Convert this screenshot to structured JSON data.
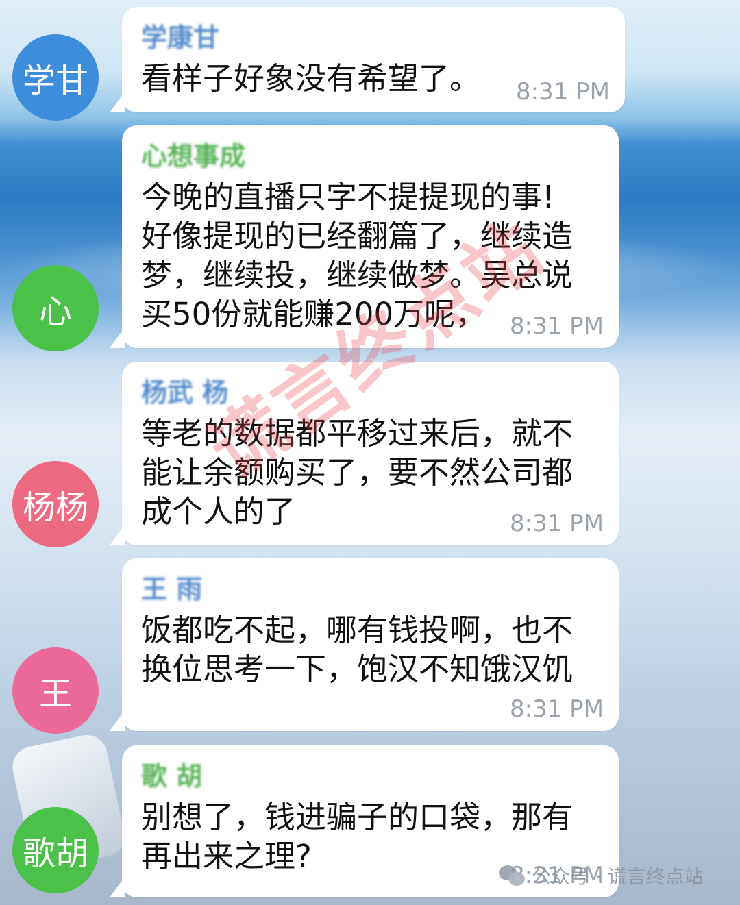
{
  "messages": [
    {
      "avatar_text": "学甘",
      "avatar_color": "#3d8ddb",
      "sender": "学康甘",
      "sender_color": "#3a78c2",
      "text": "看样子好象没有希望了。",
      "time": "8:31 PM"
    },
    {
      "avatar_text": "心",
      "avatar_color": "#4cc14a",
      "sender": "心想事成",
      "sender_color": "#3aa63a",
      "text": "今晚的直播只字不提提现的事!\n好像提现的已经翻篇了，继续造\n梦，继续投，继续做梦。吴总说\n买50份就能赚200万呢，",
      "time": "8:31 PM"
    },
    {
      "avatar_text": "杨杨",
      "avatar_color": "#ec6a82",
      "sender": "杨武 杨",
      "sender_color": "#3a78c2",
      "text": "等老的数据都平移过来后，就不\n能让余额购买了，要不然公司都\n成个人的了",
      "time": "8:31 PM"
    },
    {
      "avatar_text": "王",
      "avatar_color": "#ec6a9a",
      "sender": "王 雨",
      "sender_color": "#3a78c2",
      "text": "饭都吃不起，哪有钱投啊，也不\n换位思考一下，饱汉不知饿汉饥",
      "time": "8:31 PM"
    },
    {
      "avatar_text": "歌胡",
      "avatar_color": "#4cc14a",
      "sender": "歌 胡",
      "sender_color": "#3aa63a",
      "text": "别想了，钱进骗子的口袋，那有\n再出来之理?",
      "time": "8:31 PM"
    }
  ],
  "watermark": "谎言终点站",
  "footer": {
    "icon": "wechat-icon",
    "label": "公众号 · 谎言终点站"
  }
}
